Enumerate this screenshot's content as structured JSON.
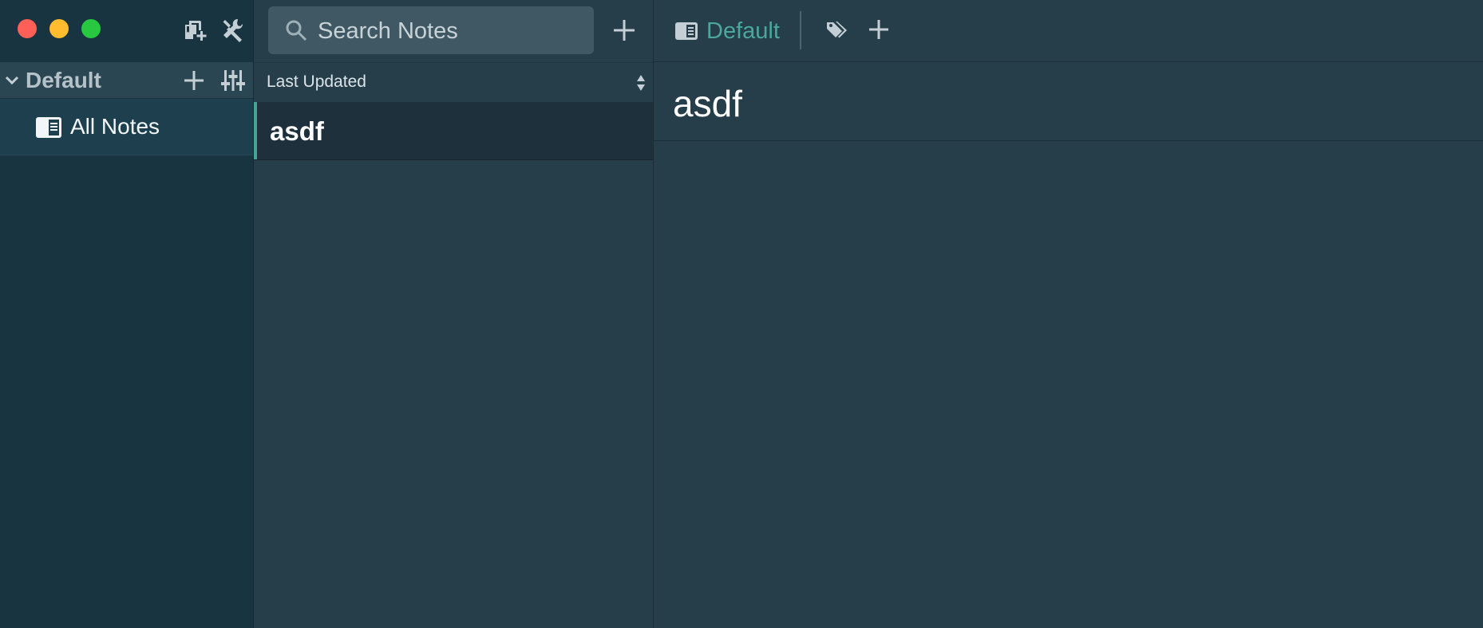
{
  "window": {
    "controls": [
      "close",
      "minimize",
      "maximize"
    ]
  },
  "sidebar": {
    "tools": [
      {
        "icon": "add-storage-icon"
      },
      {
        "icon": "tools-icon"
      }
    ],
    "storage": {
      "name": "Default",
      "expanded": true
    },
    "nav": [
      {
        "label": "All Notes",
        "icon": "all-notes-icon",
        "selected": true
      }
    ]
  },
  "notelist": {
    "search": {
      "placeholder": "Search Notes",
      "value": ""
    },
    "sort": {
      "label": "Last Updated"
    },
    "notes": [
      {
        "title": "asdf",
        "selected": true
      }
    ]
  },
  "editor": {
    "folder": {
      "label": "Default"
    },
    "title": "asdf"
  },
  "colors": {
    "accent": "#4ba89d",
    "sidebar_bg": "#183441",
    "panel_bg": "#263d4a",
    "selected_note_bg": "#1d303c"
  }
}
